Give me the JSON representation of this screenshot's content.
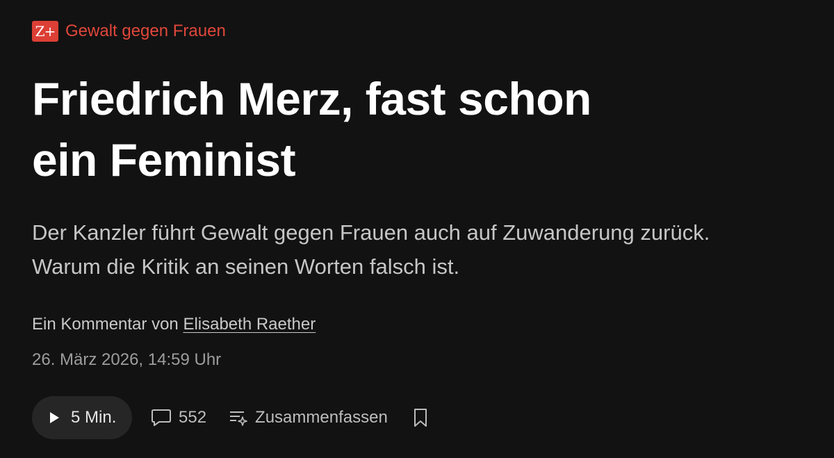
{
  "article": {
    "badge": "Z+",
    "kicker": "Gewalt gegen Frauen",
    "headline_lines": [
      "Friedrich Merz, fast schon",
      "ein Feminist"
    ],
    "lead_lines": [
      "Der Kanzler führt Gewalt gegen Frauen auch auf Zuwanderung zurück.",
      "Warum die Kritik an seinen Worten falsch ist."
    ],
    "byline_prefix": "Ein Kommentar von ",
    "author": "Elisabeth Raether",
    "date": "26. März 2026, 14:59 Uhr"
  },
  "actions": {
    "read_time": "5 Min.",
    "comment_count": "552",
    "summarize_label": "Zusammenfassen"
  },
  "icons": {
    "play": "play-icon",
    "comments": "speech-bubble-icon",
    "summarize": "sparkle-list-icon",
    "bookmark": "bookmark-icon"
  },
  "colors": {
    "background": "#121212",
    "accent": "#dc3f35",
    "kicker_text": "#e0473b"
  }
}
